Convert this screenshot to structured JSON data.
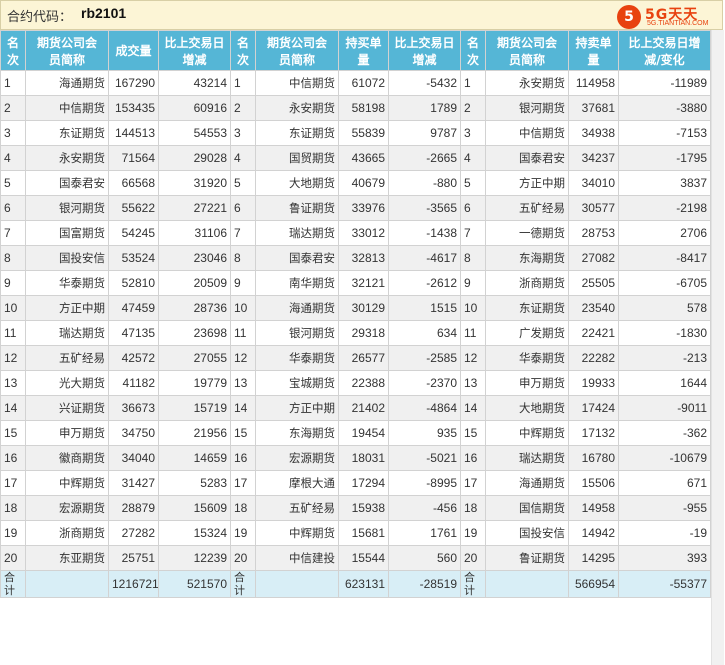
{
  "title": {
    "label": "合约代码：",
    "code": "rb2101"
  },
  "logo": {
    "mark": "5",
    "text": "5G天天",
    "subtext": "5G.TIANTIAN.COM"
  },
  "header": {
    "c0": [
      "名",
      "次"
    ],
    "c1": [
      "期货公司会",
      "员简称"
    ],
    "c2": "成交量",
    "c3": [
      "比上交易日",
      "增减"
    ],
    "c4": [
      "名",
      "次"
    ],
    "c5": [
      "期货公司会",
      "员简称"
    ],
    "c6": [
      "持买单",
      "量"
    ],
    "c7": [
      "比上交易日",
      "增减"
    ],
    "c8": [
      "名",
      "次"
    ],
    "c9": [
      "期货公司会",
      "员简称"
    ],
    "c10": [
      "持卖单",
      "量"
    ],
    "c11": [
      "比上交易日增",
      "减/变化"
    ]
  },
  "rows": [
    [
      "1",
      "海通期货",
      "167290",
      "43214",
      "1",
      "中信期货",
      "61072",
      "-5432",
      "1",
      "永安期货",
      "114958",
      "-11989"
    ],
    [
      "2",
      "中信期货",
      "153435",
      "60916",
      "2",
      "永安期货",
      "58198",
      "1789",
      "2",
      "银河期货",
      "37681",
      "-3880"
    ],
    [
      "3",
      "东证期货",
      "144513",
      "54553",
      "3",
      "东证期货",
      "55839",
      "9787",
      "3",
      "中信期货",
      "34938",
      "-7153"
    ],
    [
      "4",
      "永安期货",
      "71564",
      "29028",
      "4",
      "国贸期货",
      "43665",
      "-2665",
      "4",
      "国泰君安",
      "34237",
      "-1795"
    ],
    [
      "5",
      "国泰君安",
      "66568",
      "31920",
      "5",
      "大地期货",
      "40679",
      "-880",
      "5",
      "方正中期",
      "34010",
      "3837"
    ],
    [
      "6",
      "银河期货",
      "55622",
      "27221",
      "6",
      "鲁证期货",
      "33976",
      "-3565",
      "6",
      "五矿经易",
      "30577",
      "-2198"
    ],
    [
      "7",
      "国富期货",
      "54245",
      "31106",
      "7",
      "瑞达期货",
      "33012",
      "-1438",
      "7",
      "一德期货",
      "28753",
      "2706"
    ],
    [
      "8",
      "国投安信",
      "53524",
      "23046",
      "8",
      "国泰君安",
      "32813",
      "-4617",
      "8",
      "东海期货",
      "27082",
      "-8417"
    ],
    [
      "9",
      "华泰期货",
      "52810",
      "20509",
      "9",
      "南华期货",
      "32121",
      "-2612",
      "9",
      "浙商期货",
      "25505",
      "-6705"
    ],
    [
      "10",
      "方正中期",
      "47459",
      "28736",
      "10",
      "海通期货",
      "30129",
      "1515",
      "10",
      "东证期货",
      "23540",
      "578"
    ],
    [
      "11",
      "瑞达期货",
      "47135",
      "23698",
      "11",
      "银河期货",
      "29318",
      "634",
      "11",
      "广发期货",
      "22421",
      "-1830"
    ],
    [
      "12",
      "五矿经易",
      "42572",
      "27055",
      "12",
      "华泰期货",
      "26577",
      "-2585",
      "12",
      "华泰期货",
      "22282",
      "-213"
    ],
    [
      "13",
      "光大期货",
      "41182",
      "19779",
      "13",
      "宝城期货",
      "22388",
      "-2370",
      "13",
      "申万期货",
      "19933",
      "1644"
    ],
    [
      "14",
      "兴证期货",
      "36673",
      "15719",
      "14",
      "方正中期",
      "21402",
      "-4864",
      "14",
      "大地期货",
      "17424",
      "-9011"
    ],
    [
      "15",
      "申万期货",
      "34750",
      "21956",
      "15",
      "东海期货",
      "19454",
      "935",
      "15",
      "中辉期货",
      "17132",
      "-362"
    ],
    [
      "16",
      "徽商期货",
      "34040",
      "14659",
      "16",
      "宏源期货",
      "18031",
      "-5021",
      "16",
      "瑞达期货",
      "16780",
      "-10679"
    ],
    [
      "17",
      "中辉期货",
      "31427",
      "5283",
      "17",
      "摩根大通",
      "17294",
      "-8995",
      "17",
      "海通期货",
      "15506",
      "671"
    ],
    [
      "18",
      "宏源期货",
      "28879",
      "15609",
      "18",
      "五矿经易",
      "15938",
      "-456",
      "18",
      "国信期货",
      "14958",
      "-955"
    ],
    [
      "19",
      "浙商期货",
      "27282",
      "15324",
      "19",
      "中辉期货",
      "15681",
      "1761",
      "19",
      "国投安信",
      "14942",
      "-19"
    ],
    [
      "20",
      "东亚期货",
      "25751",
      "12239",
      "20",
      "中信建投",
      "15544",
      "560",
      "20",
      "鲁证期货",
      "14295",
      "393"
    ]
  ],
  "total": {
    "label": [
      "合",
      "计"
    ],
    "volume": "1216721",
    "volume_change": "521570",
    "buy": "623131",
    "buy_change": "-28519",
    "sell": "566954",
    "sell_change": "-55377"
  }
}
